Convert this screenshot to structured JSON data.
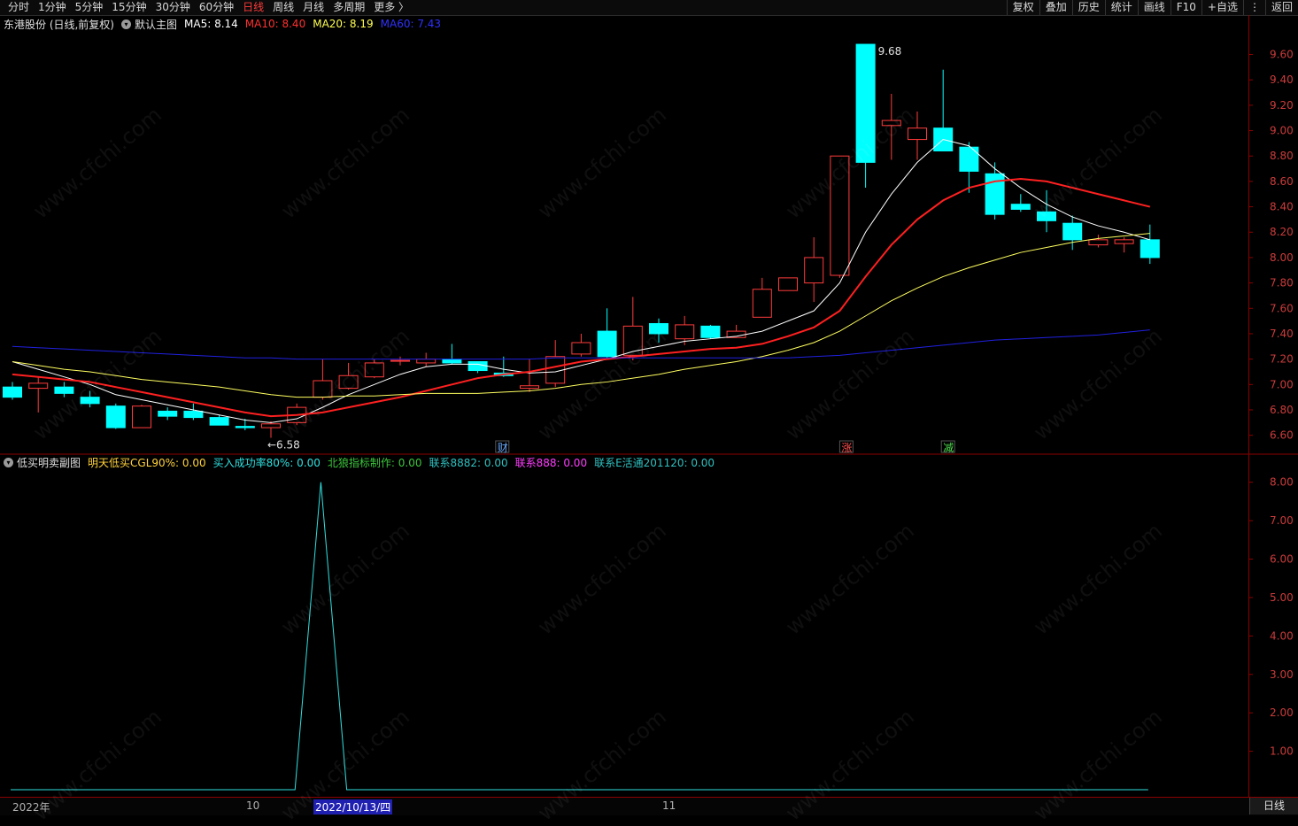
{
  "toolbar": {
    "periods": [
      "分时",
      "1分钟",
      "5分钟",
      "15分钟",
      "30分钟",
      "60分钟",
      "日线",
      "周线",
      "月线",
      "多周期",
      "更多 〉"
    ],
    "active_period": "日线",
    "buttons": [
      "复权",
      "叠加",
      "历史",
      "统计",
      "画线",
      "F10",
      "+自选",
      "返回"
    ],
    "extra_icon": "⋮"
  },
  "main_legend": {
    "stock": "东港股份 (日线,前复权)",
    "template": "默认主图",
    "ma5": "MA5: 8.14",
    "ma10": "MA10: 8.40",
    "ma20": "MA20: 8.19",
    "ma60": "MA60: 7.43"
  },
  "sub_legend": {
    "name": "低买明卖副图",
    "items": [
      {
        "text": "明天低买CGL90%: 0.00",
        "color": "#ffd23c"
      },
      {
        "text": "买入成功率80%: 0.00",
        "color": "#30e0e0"
      },
      {
        "text": "北狼指标制作: 0.00",
        "color": "#3cc83c"
      },
      {
        "text": "联系8882: 0.00",
        "color": "#30c0c0"
      },
      {
        "text": "联系888: 0.00",
        "color": "#ff3cff"
      },
      {
        "text": "联系E活通201120: 0.00",
        "color": "#30c0c0"
      }
    ]
  },
  "main_axis": {
    "labels": [
      "9.60",
      "9.40",
      "9.20",
      "9.00",
      "8.80",
      "8.60",
      "8.40",
      "8.20",
      "8.00",
      "7.80",
      "7.60",
      "7.40",
      "7.20",
      "7.00",
      "6.80",
      "6.60"
    ]
  },
  "sub_axis": {
    "labels": [
      "8.00",
      "7.00",
      "6.00",
      "5.00",
      "4.00",
      "3.00",
      "2.00",
      "1.00"
    ]
  },
  "annotations": {
    "high": "9.68",
    "low": "←6.58",
    "marks": [
      {
        "text": "财",
        "color": "#6aaaff"
      },
      {
        "text": "涨",
        "color": "#ff5050"
      },
      {
        "text": "减",
        "color": "#50e050"
      }
    ]
  },
  "date_axis": {
    "labels": [
      "2022年",
      "10",
      "2022/10/13/四",
      "11"
    ]
  },
  "period_indicator": "日线",
  "watermark": "www.cfchi.com",
  "colors": {
    "up": "#ff3b3b",
    "down": "#00ffff",
    "ma5": "#ffffff",
    "ma10": "#ff2020",
    "ma20": "#ffff60",
    "ma60": "#2020e0"
  },
  "chart_data": {
    "type": "candlestick",
    "ylim": [
      6.5,
      9.75
    ],
    "candles": [
      {
        "o": 6.98,
        "h": 7.02,
        "l": 6.88,
        "c": 6.9
      },
      {
        "o": 6.97,
        "h": 7.06,
        "l": 6.78,
        "c": 7.01
      },
      {
        "o": 6.98,
        "h": 7.02,
        "l": 6.9,
        "c": 6.93
      },
      {
        "o": 6.9,
        "h": 6.95,
        "l": 6.82,
        "c": 6.85
      },
      {
        "o": 6.83,
        "h": 6.85,
        "l": 6.65,
        "c": 6.66
      },
      {
        "o": 6.66,
        "h": 6.84,
        "l": 6.66,
        "c": 6.83
      },
      {
        "o": 6.79,
        "h": 6.82,
        "l": 6.72,
        "c": 6.75
      },
      {
        "o": 6.79,
        "h": 6.85,
        "l": 6.72,
        "c": 6.74
      },
      {
        "o": 6.74,
        "h": 6.76,
        "l": 6.68,
        "c": 6.68
      },
      {
        "o": 6.67,
        "h": 6.73,
        "l": 6.64,
        "c": 6.66
      },
      {
        "o": 6.66,
        "h": 6.71,
        "l": 6.58,
        "c": 6.69
      },
      {
        "o": 6.7,
        "h": 6.85,
        "l": 6.68,
        "c": 6.82
      },
      {
        "o": 6.9,
        "h": 7.2,
        "l": 6.88,
        "c": 7.03
      },
      {
        "o": 6.97,
        "h": 7.17,
        "l": 6.96,
        "c": 7.07
      },
      {
        "o": 7.06,
        "h": 7.2,
        "l": 7.05,
        "c": 7.17
      },
      {
        "o": 7.19,
        "h": 7.22,
        "l": 7.15,
        "c": 7.19
      },
      {
        "o": 7.17,
        "h": 7.25,
        "l": 7.14,
        "c": 7.2
      },
      {
        "o": 7.2,
        "h": 7.32,
        "l": 7.16,
        "c": 7.17
      },
      {
        "o": 7.18,
        "h": 7.18,
        "l": 7.09,
        "c": 7.11
      },
      {
        "o": 7.09,
        "h": 7.22,
        "l": 7.06,
        "c": 7.07
      },
      {
        "o": 6.97,
        "h": 7.2,
        "l": 6.94,
        "c": 6.99
      },
      {
        "o": 7.01,
        "h": 7.35,
        "l": 6.98,
        "c": 7.22
      },
      {
        "o": 7.24,
        "h": 7.4,
        "l": 7.22,
        "c": 7.33
      },
      {
        "o": 7.42,
        "h": 7.6,
        "l": 7.2,
        "c": 7.22
      },
      {
        "o": 7.23,
        "h": 7.69,
        "l": 7.19,
        "c": 7.46
      },
      {
        "o": 7.48,
        "h": 7.52,
        "l": 7.33,
        "c": 7.4
      },
      {
        "o": 7.36,
        "h": 7.54,
        "l": 7.31,
        "c": 7.47
      },
      {
        "o": 7.46,
        "h": 7.47,
        "l": 7.36,
        "c": 7.37
      },
      {
        "o": 7.37,
        "h": 7.47,
        "l": 7.37,
        "c": 7.42
      },
      {
        "o": 7.53,
        "h": 7.84,
        "l": 7.53,
        "c": 7.75
      },
      {
        "o": 7.74,
        "h": 7.81,
        "l": 7.74,
        "c": 7.84
      },
      {
        "o": 7.8,
        "h": 8.16,
        "l": 7.65,
        "c": 8.0
      },
      {
        "o": 7.86,
        "h": 8.8,
        "l": 7.84,
        "c": 8.8
      },
      {
        "o": 9.68,
        "h": 9.68,
        "l": 8.55,
        "c": 8.75
      },
      {
        "o": 9.04,
        "h": 9.29,
        "l": 8.77,
        "c": 9.08
      },
      {
        "o": 8.93,
        "h": 9.15,
        "l": 8.77,
        "c": 9.02
      },
      {
        "o": 9.02,
        "h": 9.48,
        "l": 8.87,
        "c": 8.84
      },
      {
        "o": 8.87,
        "h": 8.91,
        "l": 8.51,
        "c": 8.68
      },
      {
        "o": 8.66,
        "h": 8.75,
        "l": 8.3,
        "c": 8.34
      },
      {
        "o": 8.42,
        "h": 8.5,
        "l": 8.36,
        "c": 8.38
      },
      {
        "o": 8.36,
        "h": 8.53,
        "l": 8.2,
        "c": 8.29
      },
      {
        "o": 8.27,
        "h": 8.33,
        "l": 8.06,
        "c": 8.14
      },
      {
        "o": 8.1,
        "h": 8.18,
        "l": 8.08,
        "c": 8.14
      },
      {
        "o": 8.11,
        "h": 8.16,
        "l": 8.04,
        "c": 8.14
      },
      {
        "o": 8.14,
        "h": 8.26,
        "l": 7.95,
        "c": 8.0
      }
    ],
    "series": [
      {
        "name": "MA5",
        "values": [
          7.18,
          7.12,
          7.06,
          7.0,
          6.92,
          6.88,
          6.84,
          6.8,
          6.76,
          6.72,
          6.7,
          6.73,
          6.82,
          6.92,
          7.0,
          7.08,
          7.14,
          7.16,
          7.16,
          7.12,
          7.09,
          7.1,
          7.15,
          7.2,
          7.26,
          7.3,
          7.34,
          7.36,
          7.38,
          7.42,
          7.5,
          7.58,
          7.8,
          8.2,
          8.5,
          8.75,
          8.93,
          8.88,
          8.7,
          8.55,
          8.42,
          8.32,
          8.25,
          8.2,
          8.14
        ]
      },
      {
        "name": "MA10",
        "values": [
          7.08,
          7.06,
          7.04,
          7.02,
          6.98,
          6.94,
          6.9,
          6.86,
          6.82,
          6.78,
          6.75,
          6.76,
          6.78,
          6.82,
          6.86,
          6.9,
          6.95,
          7.0,
          7.05,
          7.08,
          7.1,
          7.14,
          7.18,
          7.2,
          7.22,
          7.24,
          7.26,
          7.28,
          7.29,
          7.32,
          7.38,
          7.45,
          7.58,
          7.85,
          8.1,
          8.3,
          8.45,
          8.55,
          8.6,
          8.62,
          8.6,
          8.55,
          8.5,
          8.45,
          8.4
        ]
      },
      {
        "name": "MA20",
        "values": [
          7.18,
          7.15,
          7.12,
          7.1,
          7.07,
          7.04,
          7.02,
          7.0,
          6.98,
          6.95,
          6.92,
          6.9,
          6.9,
          6.91,
          6.91,
          6.92,
          6.93,
          6.93,
          6.93,
          6.94,
          6.95,
          6.97,
          7.0,
          7.02,
          7.05,
          7.08,
          7.12,
          7.15,
          7.18,
          7.22,
          7.27,
          7.33,
          7.42,
          7.54,
          7.66,
          7.76,
          7.85,
          7.92,
          7.98,
          8.04,
          8.08,
          8.12,
          8.15,
          8.17,
          8.19
        ]
      },
      {
        "name": "MA60",
        "values": [
          7.3,
          7.29,
          7.28,
          7.27,
          7.26,
          7.25,
          7.24,
          7.23,
          7.22,
          7.21,
          7.21,
          7.2,
          7.2,
          7.2,
          7.2,
          7.2,
          7.2,
          7.2,
          7.2,
          7.2,
          7.2,
          7.21,
          7.21,
          7.21,
          7.21,
          7.21,
          7.21,
          7.21,
          7.21,
          7.21,
          7.21,
          7.22,
          7.23,
          7.25,
          7.27,
          7.29,
          7.31,
          7.33,
          7.35,
          7.36,
          7.37,
          7.38,
          7.39,
          7.41,
          7.43
        ]
      }
    ],
    "indicator": {
      "name": "买入成功率80%",
      "ylim": [
        0,
        8.2
      ],
      "values": [
        0,
        0,
        0,
        0,
        0,
        0,
        0,
        0,
        0,
        0,
        0,
        0,
        8,
        0,
        0,
        0,
        0,
        0,
        0,
        0,
        0,
        0,
        0,
        0,
        0,
        0,
        0,
        0,
        0,
        0,
        0,
        0,
        0,
        0,
        0,
        0,
        0,
        0,
        0,
        0,
        0,
        0,
        0,
        0,
        0
      ]
    }
  }
}
